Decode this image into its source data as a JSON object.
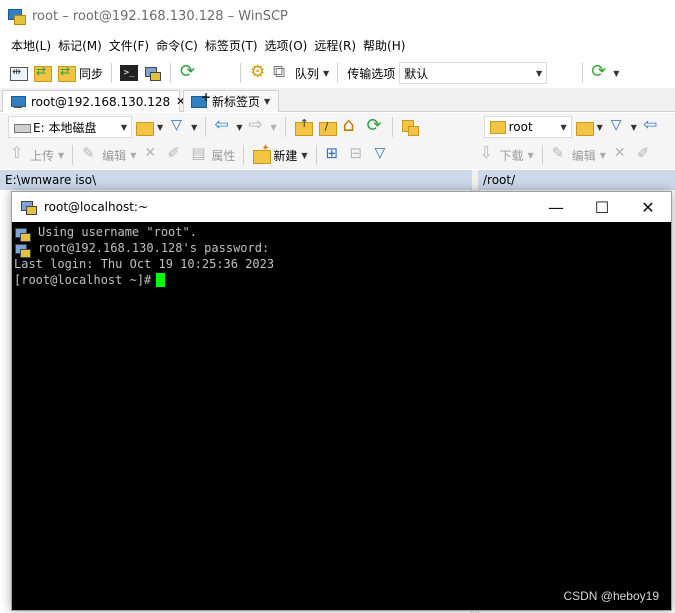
{
  "window": {
    "title": "root – root@192.168.130.128 – WinSCP"
  },
  "menubar": {
    "items": [
      "本地(L)",
      "标记(M)",
      "文件(F)",
      "命令(C)",
      "标签页(T)",
      "选项(O)",
      "远程(R)",
      "帮助(H)"
    ]
  },
  "toolbar_main": {
    "sync_label": "同步",
    "queue_label": "队列",
    "transfer_options_label": "传输选项",
    "transfer_preset_value": "默认"
  },
  "tabs": {
    "active_label": "root@192.168.130.128",
    "new_tab_label": "新标签页"
  },
  "local_panel": {
    "drive_value": "E: 本地磁盘",
    "upload_label": "上传",
    "edit_label": "编辑",
    "properties_label": "属性",
    "new_label": "新建",
    "path": "E:\\wmware iso\\"
  },
  "remote_panel": {
    "dir_value": "root",
    "download_label": "下载",
    "edit_label": "编辑",
    "path": "/root/"
  },
  "putty": {
    "title": "root@localhost:~",
    "lines": [
      "Using username \"root\".",
      "root@192.168.130.128's password:",
      "Last login: Thu Oct 19 10:25:36 2023",
      "[root@localhost ~]#"
    ]
  },
  "watermark": "CSDN @heboy19",
  "colors": {
    "path_bar": "#cdd9ea",
    "terminal_bg": "#000000",
    "terminal_fg": "#c0c0c0",
    "cursor": "#00ff00"
  }
}
